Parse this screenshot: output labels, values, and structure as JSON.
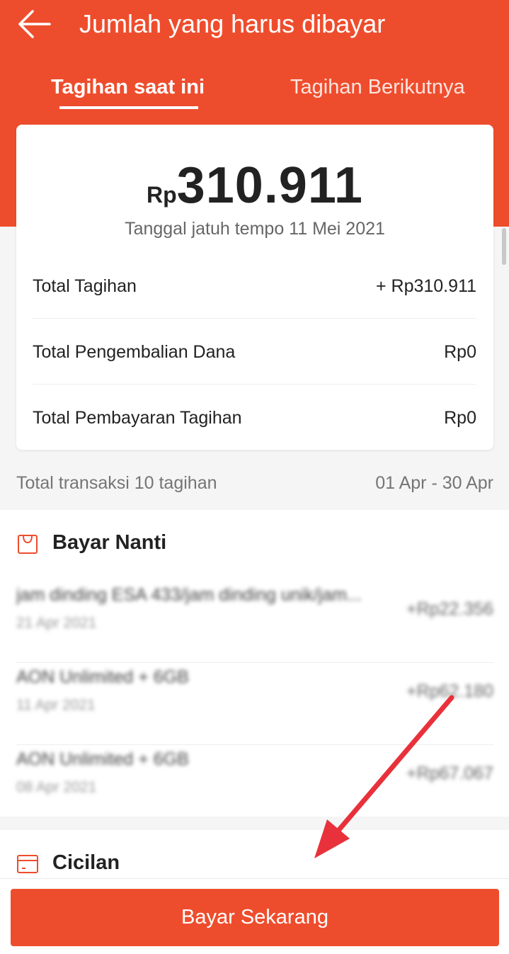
{
  "header": {
    "title": "Jumlah yang harus dibayar",
    "tabs": [
      {
        "label": "Tagihan saat ini",
        "active": true
      },
      {
        "label": "Tagihan Berikutnya",
        "active": false
      }
    ]
  },
  "bill": {
    "currency": "Rp",
    "amount": "310.911",
    "due_date": "Tanggal jatuh tempo 11 Mei 2021",
    "rows": [
      {
        "label": "Total Tagihan",
        "value": "+ Rp310.911"
      },
      {
        "label": "Total Pengembalian Dana",
        "value": "Rp0"
      },
      {
        "label": "Total Pembayaran Tagihan",
        "value": "Rp0"
      }
    ]
  },
  "summary": {
    "transactions": "Total transaksi 10 tagihan",
    "period": "01 Apr - 30 Apr"
  },
  "bayar_nanti": {
    "title": "Bayar Nanti",
    "icon": "shopping-bag-icon",
    "items": [
      {
        "name": "jam dinding ESA 433/jam dinding unik/jam...",
        "date": "21 Apr 2021",
        "price": "+Rp22.356"
      },
      {
        "name": "AON Unlimited + 6GB",
        "date": "11 Apr 2021",
        "price": "+Rp62.180"
      },
      {
        "name": "AON Unlimited + 6GB",
        "date": "08 Apr 2021",
        "price": "+Rp67.067"
      }
    ]
  },
  "cicilan": {
    "title": "Cicilan",
    "icon": "card-icon"
  },
  "footer": {
    "pay_label": "Bayar Sekarang"
  },
  "colors": {
    "brand": "#ee4d2d",
    "annotation_arrow": "#e8313a"
  }
}
